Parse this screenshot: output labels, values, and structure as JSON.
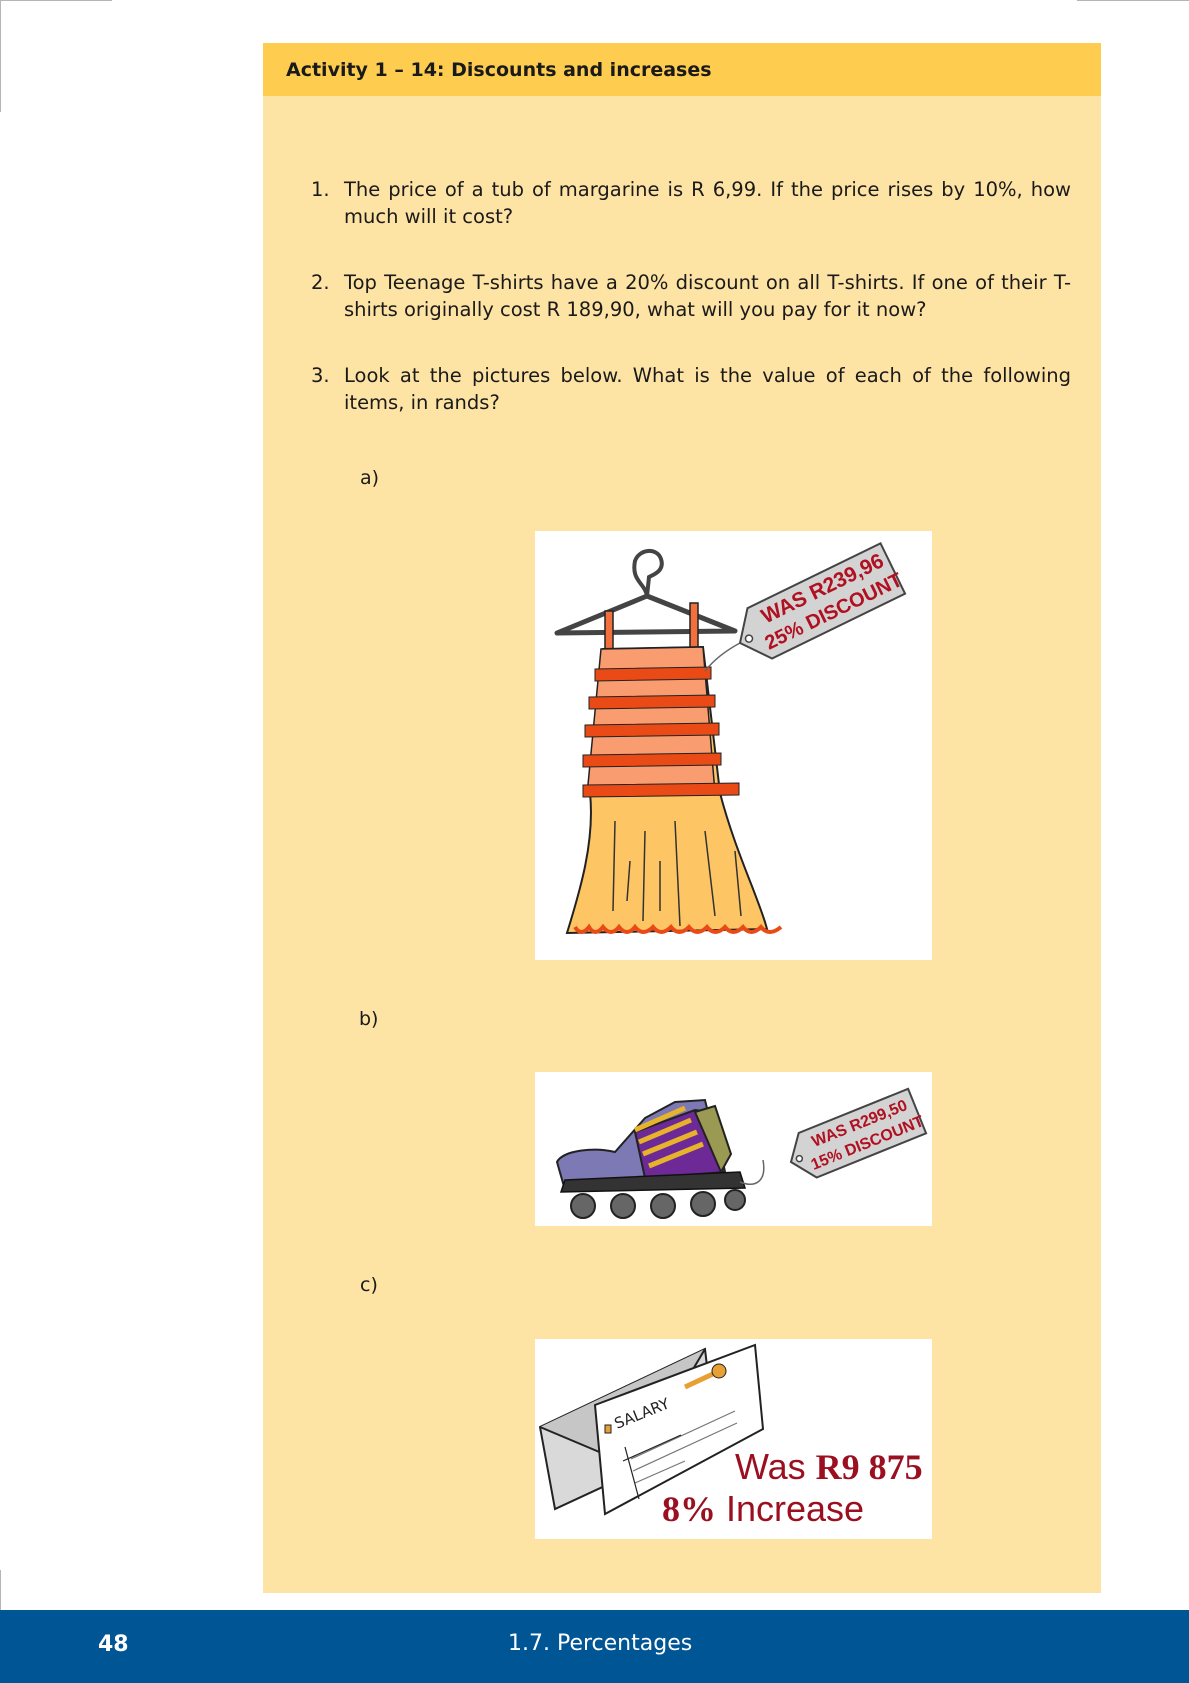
{
  "activity": {
    "title": "Activity 1 – 14:  Discounts and increases",
    "questions": [
      {
        "number": "1.",
        "text": "The price of a tub of margarine is R 6,99.  If the price rises by 10%, how much will it cost?"
      },
      {
        "number": "2.",
        "text": "Top Teenage T-shirts have a 20% discount on all T-shirts.  If one of their T-shirts originally cost R 189,90, what will you pay for it now?"
      },
      {
        "number": "3.",
        "text": "Look at the pictures below.  What is the value of each of the following items, in rands?"
      }
    ],
    "items": [
      {
        "label": "a)",
        "tag_line1": "WAS R239,96",
        "tag_line2": "25% DISCOUNT"
      },
      {
        "label": "b)",
        "tag_line1": "WAS R299,50",
        "tag_line2": "15% DISCOUNT"
      },
      {
        "label": "c)",
        "envelope_text": "SALARY",
        "was_prefix": "Was ",
        "was_amount": "R9 875",
        "increase_pct": "8%",
        "increase_word": " Increase"
      }
    ]
  },
  "footer": {
    "page_number": "48",
    "section": "1.7.   Percentages"
  },
  "colors": {
    "header_bg": "#fecc4f",
    "box_bg": "#fde3a4",
    "footer_bg": "#005595",
    "tag_text": "#b01020",
    "price_text": "#9b1020"
  }
}
